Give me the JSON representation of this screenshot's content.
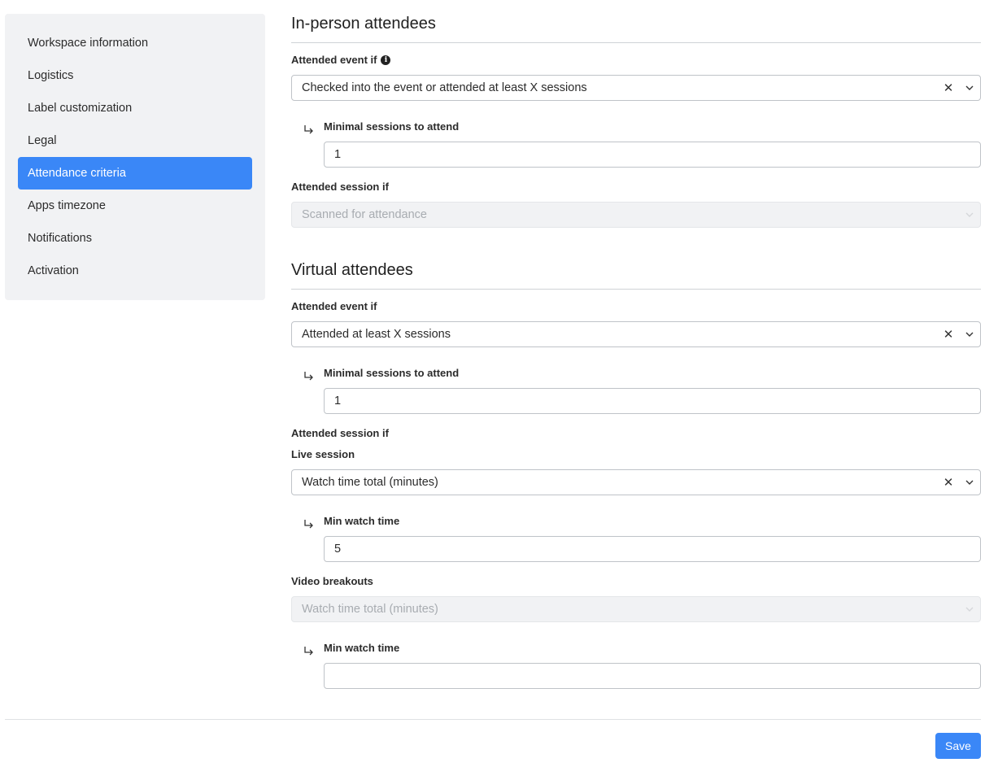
{
  "sidebar": {
    "items": [
      {
        "label": "Workspace information"
      },
      {
        "label": "Logistics"
      },
      {
        "label": "Label customization"
      },
      {
        "label": "Legal"
      },
      {
        "label": "Attendance criteria",
        "active": true
      },
      {
        "label": "Apps timezone"
      },
      {
        "label": "Notifications"
      },
      {
        "label": "Activation"
      }
    ]
  },
  "in_person": {
    "title": "In-person attendees",
    "event_label": "Attended event if",
    "event_value": "Checked into the event or attended at least X sessions",
    "min_sessions_label": "Minimal sessions to attend",
    "min_sessions_value": "1",
    "session_label": "Attended session if",
    "session_value": "Scanned for attendance"
  },
  "virtual": {
    "title": "Virtual attendees",
    "event_label": "Attended event if",
    "event_value": "Attended at least X sessions",
    "min_sessions_label": "Minimal sessions to attend",
    "min_sessions_value": "1",
    "session_label": "Attended session if",
    "live_label": "Live session",
    "live_value": "Watch time total (minutes)",
    "live_min_label": "Min watch time",
    "live_min_value": "5",
    "breakout_label": "Video breakouts",
    "breakout_value": "Watch time total (minutes)",
    "breakout_min_label": "Min watch time",
    "breakout_min_value": ""
  },
  "footer": {
    "save_label": "Save"
  },
  "icons": {
    "info": "info-icon",
    "clear": "close-icon",
    "dropdown": "chevron-down-icon",
    "sub": "return-arrow-icon"
  },
  "colors": {
    "accent": "#3a87f7"
  },
  "glyphs": {
    "clear": "✕",
    "info": "i"
  }
}
